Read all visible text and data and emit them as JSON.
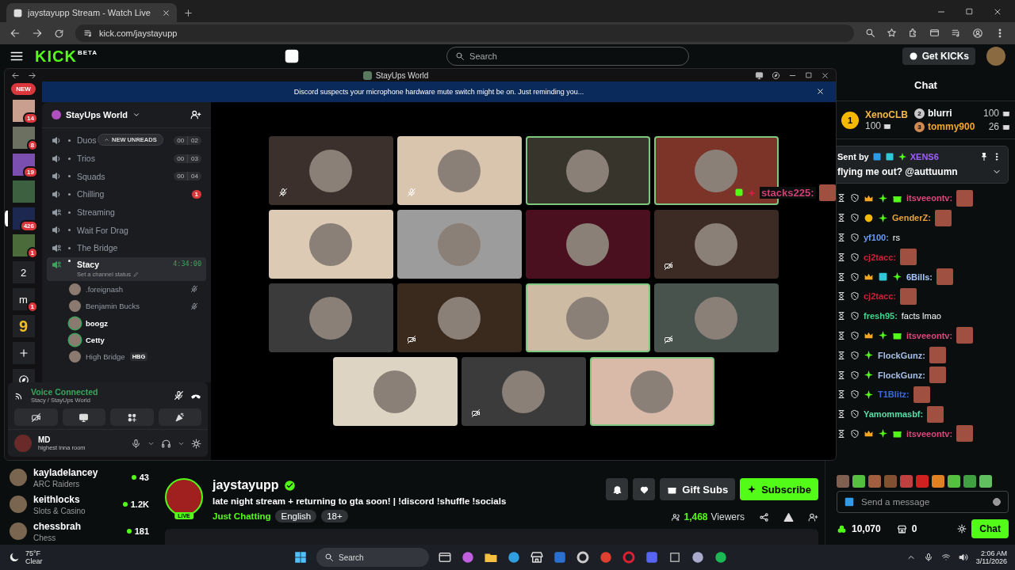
{
  "browser": {
    "tab_title": "jaystayupp Stream - Watch Live",
    "url": "kick.com/jaystayupp"
  },
  "kick": {
    "logo": "KICK",
    "logo_badge": "BETA",
    "search_placeholder": "Search",
    "get_kicks": "Get KICKs",
    "sidebar": [
      {
        "name": "kayladelancey",
        "category": "ARC Raiders",
        "viewers": "43"
      },
      {
        "name": "keithlocks",
        "category": "Slots & Casino",
        "viewers": "1.2K"
      },
      {
        "name": "chessbrah",
        "category": "Chess",
        "viewers": "181"
      }
    ],
    "stream": {
      "streamer": "jaystayupp",
      "live": "LIVE",
      "title": "late night stream + returning to gta soon! | !discord !shuffle !socials",
      "category": "Just Chatting",
      "tags": [
        "English",
        "18+"
      ],
      "gift": "Gift Subs",
      "subscribe": "Subscribe",
      "viewers": "1,468",
      "viewers_label": "Viewers"
    },
    "chat": {
      "title": "Chat",
      "leaders": [
        {
          "rank": "1",
          "name": "XenoCLB",
          "amount": "100"
        },
        {
          "rank": "2",
          "name": "blurri",
          "amount": "100"
        },
        {
          "rank": "3",
          "name": "tommy900",
          "amount": "26"
        }
      ],
      "pinned": {
        "sent_by": "Sent by",
        "user": "XENS6",
        "text": "flying me out? @auttuumn"
      },
      "messages": [
        {
          "user": "itsveeontv:",
          "color": "#e0457b",
          "kind": "emote",
          "badges": [
            {
              "kind": "crown"
            },
            {
              "kind": "sparkle"
            },
            {
              "kind": "gift"
            }
          ]
        },
        {
          "user": "GenderZ:",
          "color": "#e8a33a",
          "kind": "emote",
          "badges": [
            {
              "kind": "coin"
            },
            {
              "kind": "sparkle"
            }
          ]
        },
        {
          "user": "yf100:",
          "color": "#6b9bf0",
          "kind": "text",
          "text": "rs"
        },
        {
          "user": "cj2tacc:",
          "color": "#d0203a",
          "kind": "emote"
        },
        {
          "user": "6Bills:",
          "color": "#a8c8ff",
          "kind": "emote",
          "badges": [
            {
              "kind": "crown"
            },
            {
              "kind": "gem"
            },
            {
              "kind": "sparkle"
            }
          ]
        },
        {
          "user": "cj2tacc:",
          "color": "#d0203a",
          "kind": "emote"
        },
        {
          "user": "fresh95:",
          "color": "#3ed68c",
          "kind": "text",
          "text": "facts lmao"
        },
        {
          "user": "itsveeontv:",
          "color": "#e0457b",
          "kind": "emote",
          "badges": [
            {
              "kind": "crown"
            },
            {
              "kind": "sparkle"
            },
            {
              "kind": "gift"
            }
          ]
        },
        {
          "user": "FlockGunz:",
          "color": "#a8c0e8",
          "kind": "emote",
          "badges": [
            {
              "kind": "sparkle"
            }
          ]
        },
        {
          "user": "FlockGunz:",
          "color": "#a8c0e8",
          "kind": "emote",
          "badges": [
            {
              "kind": "sparkle"
            }
          ]
        },
        {
          "user": "T1Blitz:",
          "color": "#3a6ae0",
          "kind": "emote",
          "badges": [
            {
              "kind": "sparkle"
            }
          ]
        },
        {
          "user": "Yamommasbf:",
          "color": "#55e0a8",
          "kind": "emote"
        },
        {
          "user": "itsveeontv:",
          "color": "#e0457b",
          "kind": "emote",
          "badges": [
            {
              "kind": "crown"
            },
            {
              "kind": "sparkle"
            },
            {
              "kind": "gift"
            }
          ]
        }
      ],
      "input_placeholder": "Send a message",
      "points": "10,070",
      "store": "0",
      "send": "Chat"
    }
  },
  "discord": {
    "window_title": "StayUps World",
    "notice": "Discord suspects your microphone hardware mute switch might be on. Just reminding you...",
    "servers": [
      {
        "kind": "new",
        "label": "NEW"
      },
      {
        "kind": "avatar",
        "badge": "14",
        "selected": false
      },
      {
        "kind": "avatar",
        "badge": "8",
        "selected": false
      },
      {
        "kind": "avatar",
        "badge": "19",
        "selected": false
      },
      {
        "kind": "avatar",
        "selected": false
      },
      {
        "kind": "avatar",
        "badge": "426",
        "selected": true
      },
      {
        "kind": "avatar",
        "badge": "1",
        "selected": false
      },
      {
        "kind": "letter",
        "label": "2",
        "selected": false
      },
      {
        "kind": "letter",
        "label": "m",
        "badge": "1",
        "selected": false
      },
      {
        "kind": "letter",
        "label": "9",
        "selected": false
      },
      {
        "kind": "add",
        "selected": false
      },
      {
        "kind": "discover",
        "selected": false
      }
    ],
    "server_name": "StayUps World",
    "new_unreads": "NEW UNREADS",
    "channels": [
      {
        "name": "Duos",
        "kind": "voice",
        "selected": false,
        "limit": [
          "00",
          "02"
        ]
      },
      {
        "name": "Trios",
        "kind": "voice",
        "selected": false,
        "limit": [
          "00",
          "03"
        ]
      },
      {
        "name": "Squads",
        "kind": "voice",
        "selected": false,
        "limit": [
          "00",
          "04"
        ]
      },
      {
        "name": "Chilling",
        "kind": "voice",
        "selected": false,
        "badge": "1"
      },
      {
        "name": "Streaming",
        "kind": "stage",
        "selected": false
      },
      {
        "name": "Wait For Drag",
        "kind": "voice",
        "selected": false
      },
      {
        "name": "The Bridge",
        "kind": "stage",
        "selected": false
      },
      {
        "name": "Stacy",
        "kind": "stage",
        "selected": true,
        "timer": "4:34:00",
        "status": "Set a channel status"
      }
    ],
    "members": [
      {
        "name": ".foreignash",
        "speaking": false,
        "muted": true
      },
      {
        "name": "Benjamin Bucks",
        "speaking": false,
        "muted": true
      },
      {
        "name": "boogz",
        "speaking": true,
        "muted": false
      },
      {
        "name": "Cetty",
        "speaking": true,
        "muted": false
      },
      {
        "name": "High Bridge",
        "speaking": false,
        "muted": false,
        "tag": "HBG"
      }
    ],
    "voice": {
      "status": "Voice Connected",
      "location": "Stacy / StayUps World"
    },
    "user": {
      "name": "MD",
      "status": "highest inna room"
    },
    "tiles": [
      {
        "color": "#3b302c",
        "speaking": false,
        "muted": true,
        "video_off": false
      },
      {
        "color": "#d9c4ae",
        "speaking": false,
        "muted": true,
        "video_off": false
      },
      {
        "color": "#37352b",
        "speaking": true,
        "muted": false,
        "video_off": false
      },
      {
        "color": "#7d3428",
        "speaking": true,
        "muted": false,
        "video_off": false
      },
      {
        "color": "#dccab4",
        "speaking": false,
        "muted": false,
        "video_off": false
      },
      {
        "color": "#9c9c9c",
        "speaking": false,
        "muted": false,
        "video_off": false
      },
      {
        "color": "#4a1020",
        "speaking": false,
        "muted": false,
        "video_off": false
      },
      {
        "color": "#3c2a25",
        "speaking": false,
        "muted": false,
        "video_off": true
      },
      {
        "color": "#3b3b3b",
        "speaking": false,
        "muted": false,
        "video_off": false
      },
      {
        "color": "#3a2a1e",
        "speaking": false,
        "muted": false,
        "video_off": true
      },
      {
        "color": "#cdbca3",
        "speaking": true,
        "muted": false,
        "video_off": false
      },
      {
        "color": "#48534e",
        "speaking": false,
        "muted": false,
        "video_off": true
      },
      {
        "color": "#ddd4c4",
        "speaking": false,
        "muted": false,
        "video_off": false
      },
      {
        "color": "#3b3b3b",
        "speaking": false,
        "muted": false,
        "video_off": true
      },
      {
        "color": "#d9b9a8",
        "speaking": true,
        "muted": false,
        "video_off": false
      }
    ]
  },
  "floating_message": {
    "username": "stacks225:"
  },
  "taskbar": {
    "temp": "75°F",
    "weather": "Clear",
    "search": "Search",
    "time": "2:06 AM",
    "date": "3/11/2026"
  }
}
